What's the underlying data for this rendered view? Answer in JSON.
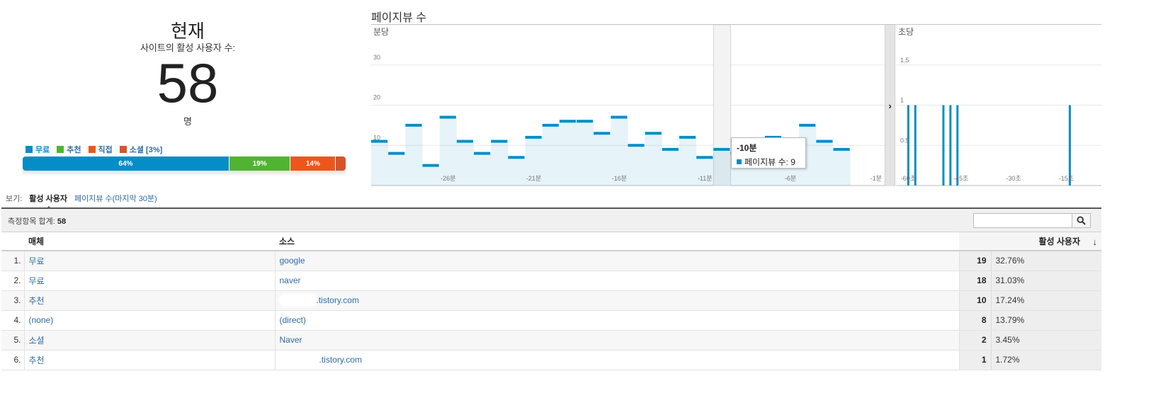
{
  "summary_panel": {
    "title": "현재",
    "label": "사이트의 활성 사용자 수:",
    "active_users": "58",
    "unit": "명"
  },
  "legend": [
    {
      "label": "무료",
      "color": "#058dc7"
    },
    {
      "label": "추천",
      "color": "#50b432"
    },
    {
      "label": "직접",
      "color": "#ed561b"
    },
    {
      "label": "소셜 [3%]",
      "color": "#d6542a"
    }
  ],
  "share_bar": [
    {
      "label": "64%",
      "fraction": 0.64,
      "color": "#058dc7"
    },
    {
      "label": "19%",
      "fraction": 0.19,
      "color": "#50b432"
    },
    {
      "label": "14%",
      "fraction": 0.14,
      "color": "#ed561b"
    },
    {
      "label": "",
      "fraction": 0.03,
      "color": "#d6542a"
    }
  ],
  "chart_data": [
    {
      "type": "bar",
      "title": "페이지뷰 수",
      "panel_label": "분당",
      "ylim": [
        0,
        40
      ],
      "y_ticks": [
        10,
        20,
        30
      ],
      "x_ticks": [
        {
          "x": -26,
          "label": "-26분"
        },
        {
          "x": -21,
          "label": "-21분"
        },
        {
          "x": -16,
          "label": "-16분"
        },
        {
          "x": -11,
          "label": "-11분"
        },
        {
          "x": -6,
          "label": "-6분"
        },
        {
          "x": -1,
          "label": "-1분"
        }
      ],
      "x": [
        -30,
        -29,
        -28,
        -27,
        -26,
        -25,
        -24,
        -23,
        -22,
        -21,
        -20,
        -19,
        -18,
        -17,
        -16,
        -15,
        -14,
        -13,
        -12,
        -11,
        -10,
        -9,
        -8,
        -7,
        -6,
        -5,
        -4,
        -3,
        -2,
        -1
      ],
      "values": [
        11,
        8,
        15,
        5,
        17,
        11,
        8,
        11,
        7,
        12,
        15,
        16,
        16,
        13,
        17,
        10,
        13,
        9,
        12,
        7,
        9,
        8,
        11,
        12,
        9,
        15,
        11,
        9,
        0,
        0
      ],
      "color": "#058dc7",
      "grid": true
    },
    {
      "type": "bar",
      "panel_label": "초당",
      "ylim": [
        0,
        2
      ],
      "y_ticks": [
        {
          "v": 0.5,
          "label": "0.5"
        },
        {
          "v": 1,
          "label": "1"
        },
        {
          "v": 1.5,
          "label": "1.5"
        }
      ],
      "x_ticks": [
        {
          "x": -60,
          "label": "-60초"
        },
        {
          "x": -45,
          "label": "-45초"
        },
        {
          "x": -30,
          "label": "-30초"
        },
        {
          "x": -15,
          "label": "-15초"
        }
      ],
      "x": [
        -60,
        -58,
        -50,
        -48,
        -46,
        -14
      ],
      "values": [
        1,
        1,
        1,
        1,
        1,
        1
      ],
      "color": "#058dc7",
      "grid": true
    }
  ],
  "tooltip": {
    "title": "-10분",
    "series": "페이지뷰 수",
    "value": "9",
    "row_text": "페이지뷰 수: 9"
  },
  "view": {
    "label": "보기:",
    "active_tab": "활성 사용자",
    "other_tab": "페이지뷰 수(마지막 30분)"
  },
  "table": {
    "summary_label": "측정항목 합계:",
    "summary_total": "58",
    "search_placeholder": "",
    "columns": {
      "medium": "매체",
      "source": "소스",
      "users": "활성 사용자"
    },
    "rows": [
      {
        "idx": "1.",
        "medium": "무료",
        "source": "google",
        "value": "19",
        "pct": "32.76%"
      },
      {
        "idx": "2.",
        "medium": "무료",
        "source": "naver",
        "value": "18",
        "pct": "31.03%"
      },
      {
        "idx": "3.",
        "medium": "추천",
        "source": ".tistory.com",
        "value": "10",
        "pct": "17.24%",
        "redact": 52
      },
      {
        "idx": "4.",
        "medium": "(none)",
        "source": "(direct)",
        "value": "8",
        "pct": "13.79%"
      },
      {
        "idx": "5.",
        "medium": "소셜",
        "source": "Naver",
        "value": "2",
        "pct": "3.45%"
      },
      {
        "idx": "6.",
        "medium": "추천",
        "source": ".tistory.com",
        "value": "1",
        "pct": "1.72%",
        "redact": 56
      }
    ]
  }
}
